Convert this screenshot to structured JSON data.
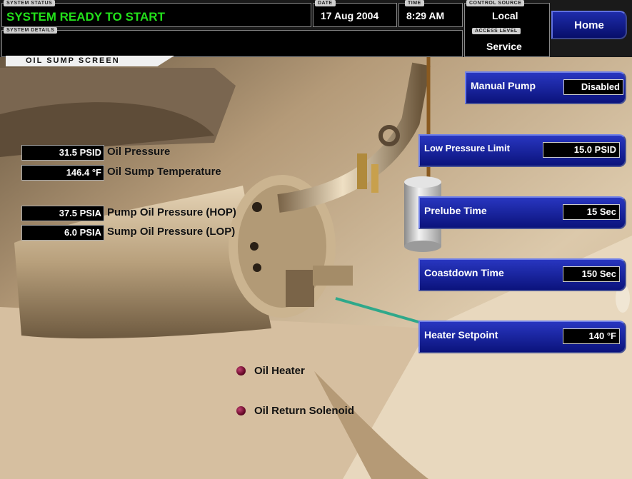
{
  "header": {
    "system_status_tag": "SYSTEM STATUS",
    "system_status": "SYSTEM READY TO START",
    "system_details_tag": "SYSTEM DETAILS",
    "system_details": "",
    "date_tag": "DATE",
    "date": "17 Aug 2004",
    "time_tag": "TIME",
    "time": "8:29 AM",
    "control_source_tag": "CONTROL SOURCE",
    "control_source": "Local",
    "access_level_tag": "ACCESS LEVEL",
    "access_level": "Service",
    "home_label": "Home"
  },
  "screen_title": "OIL SUMP SCREEN",
  "readouts": [
    {
      "value": "31.5 PSID",
      "label": "Oil Pressure"
    },
    {
      "value": "146.4 °F",
      "label": "Oil Sump Temperature"
    },
    {
      "value": "37.5 PSIA",
      "label": "Pump Oil Pressure (HOP)"
    },
    {
      "value": "6.0 PSIA",
      "label": "Sump Oil Pressure (LOP)"
    }
  ],
  "setpoints": [
    {
      "label": "Manual Pump",
      "value": "Disabled"
    },
    {
      "label": "Low Pressure Limit",
      "value": "15.0 PSID"
    },
    {
      "label": "Prelube Time",
      "value": "15 Sec"
    },
    {
      "label": "Coastdown Time",
      "value": "150 Sec"
    },
    {
      "label": "Heater Setpoint",
      "value": "140 °F"
    }
  ],
  "indicators": [
    {
      "label": "Oil Heater",
      "state": "off"
    },
    {
      "label": "Oil Return Solenoid",
      "state": "off"
    }
  ],
  "colors": {
    "status_text": "#22e01a",
    "panel_blue": "#0b137c",
    "indicator_off": "#6a0a2a"
  }
}
